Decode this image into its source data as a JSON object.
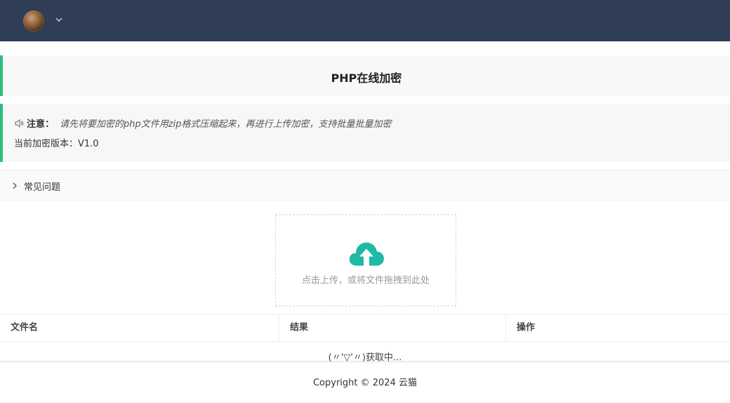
{
  "header": {
    "avatar_icon": "user-avatar-icon",
    "menu_icon": "chevron-down-icon",
    "background": "#2f3d55"
  },
  "title": {
    "text": "PHP在线加密"
  },
  "notice": {
    "icon": "speaker-icon",
    "label": "注意：",
    "text": "请先将要加密的php文件用zip格式压缩起来，再进行上传加密，支持批量批量加密",
    "version": "当前加密版本：V1.0",
    "accent": "#2dbe7e"
  },
  "faq": {
    "icon": "chevron-right-icon",
    "label": "常见问题"
  },
  "upload": {
    "icon": "cloud-upload-icon",
    "text": "点击上传，或将文件拖拽到此处",
    "icon_color": "#1fbaa6"
  },
  "table": {
    "columns": [
      "文件名",
      "结果",
      "操作"
    ],
    "loading_text": "(〃'▽'〃)获取中..."
  },
  "footer": {
    "text": "Copyright © 2024 云猫"
  }
}
